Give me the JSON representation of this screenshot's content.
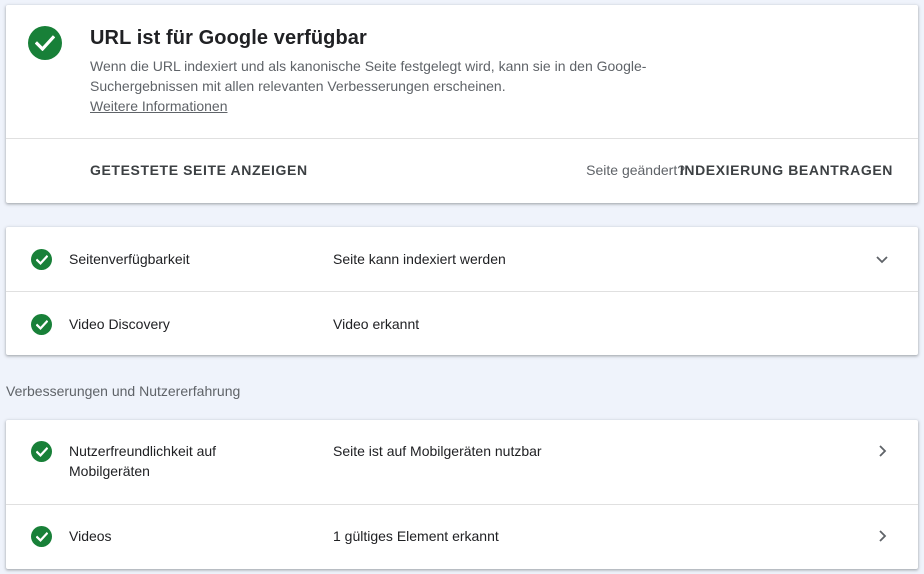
{
  "summary": {
    "title": "URL ist für Google verfügbar",
    "description": "Wenn die URL indexiert und als kanonische Seite festgelegt wird, kann sie in den Google-Suchergebnissen mit allen relevanten Verbesserungen erscheinen.",
    "more_link": "Weitere Informationen",
    "view_tested_page": "GETESTETE SEITE ANZEIGEN",
    "page_changed": "Seite geändert?",
    "request_indexing": "INDEXIERUNG BEANTRAGEN",
    "status_icon": "check-circle-icon"
  },
  "coverage": {
    "rows": [
      {
        "label": "Seitenverfügbarkeit",
        "value": "Seite kann indexiert werden",
        "icon": "check-circle-icon",
        "action_icon": "chevron-down-icon"
      },
      {
        "label": "Video Discovery",
        "value": "Video erkannt",
        "icon": "check-circle-icon"
      }
    ]
  },
  "enhancements": {
    "heading": "Verbesserungen und Nutzererfahrung",
    "rows": [
      {
        "label": "Nutzerfreundlichkeit auf Mobilgeräten",
        "value": "Seite ist auf Mobilgeräten nutzbar",
        "icon": "check-circle-icon",
        "action_icon": "chevron-right-icon"
      },
      {
        "label": "Videos",
        "value": "1 gültiges Element erkannt",
        "icon": "check-circle-icon",
        "action_icon": "chevron-right-icon"
      }
    ]
  },
  "colors": {
    "success_green": "#188038",
    "background": "#eff3fb",
    "card": "#ffffff",
    "secondary_text": "#5f6368"
  }
}
